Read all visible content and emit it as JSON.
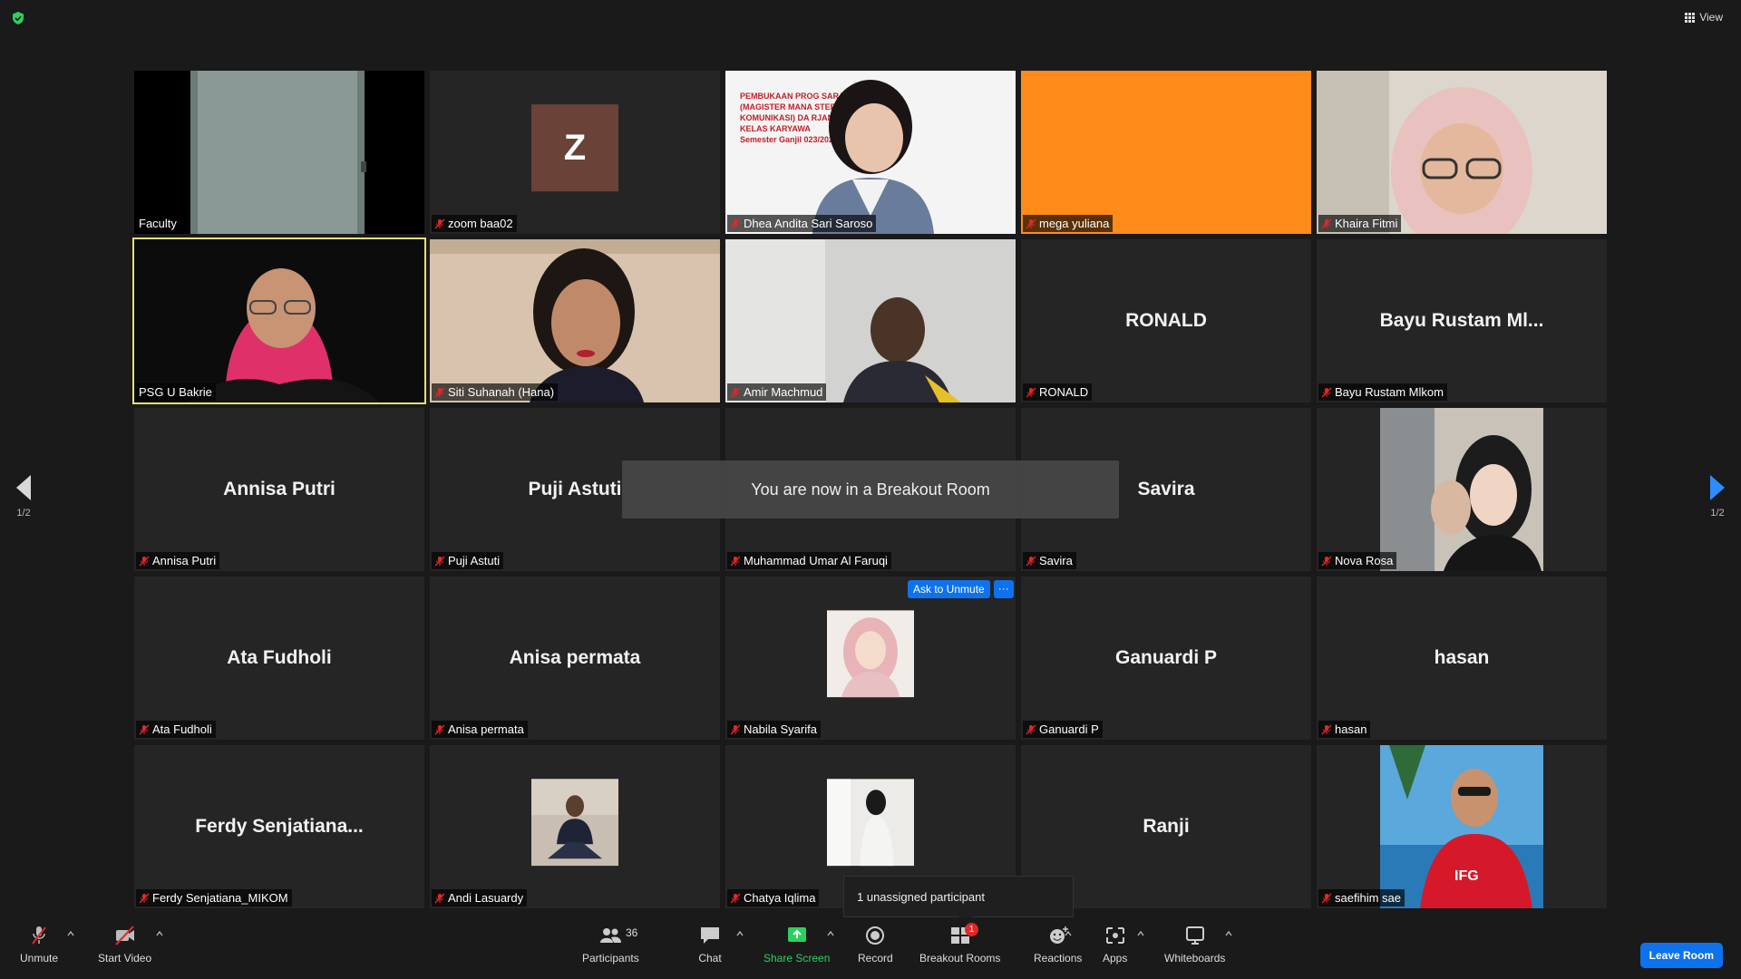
{
  "header": {
    "view_label": "View"
  },
  "page_indicator": {
    "left": "1/2",
    "right": "1/2"
  },
  "tiles": [
    {
      "name": "Faculty",
      "big": ""
    },
    {
      "name": "zoom baa02",
      "big": "",
      "initial": "Z"
    },
    {
      "name": "Dhea Andita Sari Saroso",
      "big": ""
    },
    {
      "name": "mega yuliana",
      "big": ""
    },
    {
      "name": "Khaira Fitmi",
      "big": ""
    },
    {
      "name": "PSG U Bakrie",
      "big": ""
    },
    {
      "name": "Siti Suhanah (Hana)",
      "big": ""
    },
    {
      "name": "Amir Machmud",
      "big": ""
    },
    {
      "name": "RONALD",
      "big": "RONALD"
    },
    {
      "name": "Bayu Rustam Mlkom",
      "big": "Bayu Rustam Ml..."
    },
    {
      "name": "Annisa Putri",
      "big": "Annisa Putri"
    },
    {
      "name": "Puji Astuti",
      "big": "Puji Astuti"
    },
    {
      "name": "Muhammad Umar Al Faruqi",
      "big": ""
    },
    {
      "name": "Savira",
      "big": "Savira"
    },
    {
      "name": "Nova Rosa",
      "big": ""
    },
    {
      "name": "Ata Fudholi",
      "big": "Ata Fudholi"
    },
    {
      "name": "Anisa permata",
      "big": "Anisa permata"
    },
    {
      "name": "Nabila Syarifa",
      "big": ""
    },
    {
      "name": "Ganuardi P",
      "big": "Ganuardi P"
    },
    {
      "name": "hasan",
      "big": "hasan"
    },
    {
      "name": "Ferdy Senjatiana_MIKOM",
      "big": "Ferdy  Senjatiana..."
    },
    {
      "name": "Andi Lasuardy",
      "big": ""
    },
    {
      "name": "Chatya Iqlima",
      "big": ""
    },
    {
      "name": "",
      "big": "Ranji"
    },
    {
      "name": "saefihim sae",
      "big": ""
    }
  ],
  "slide_text": {
    "line1": "PEMBUKAAN PROG          SARJANA",
    "line2": "(MAGISTER MANA          STER ILMU",
    "line3": "KOMUNIKASI) DA          RJANA S1",
    "line4": "KELAS KARYAWA",
    "line5": "Semester Ganjil          023/2024"
  },
  "shirt_text": "IFG",
  "toast": "You are now in a Breakout Room",
  "ask_to_unmute": "Ask to Unmute",
  "more": "···",
  "popup": "1 unassigned participant",
  "toolbar": {
    "unmute": "Unmute",
    "start_video": "Start Video",
    "participants": "Participants",
    "participants_count": "36",
    "chat": "Chat",
    "share_screen": "Share Screen",
    "record": "Record",
    "breakout_rooms": "Breakout Rooms",
    "breakout_badge": "1",
    "reactions": "Reactions",
    "apps": "Apps",
    "whiteboards": "Whiteboards",
    "leave_room": "Leave Room"
  },
  "colors": {
    "accent": "#0e72ed",
    "speaking": "#e6e26f",
    "share": "#2bd05f",
    "orange_tile": "#ff8c1a"
  }
}
